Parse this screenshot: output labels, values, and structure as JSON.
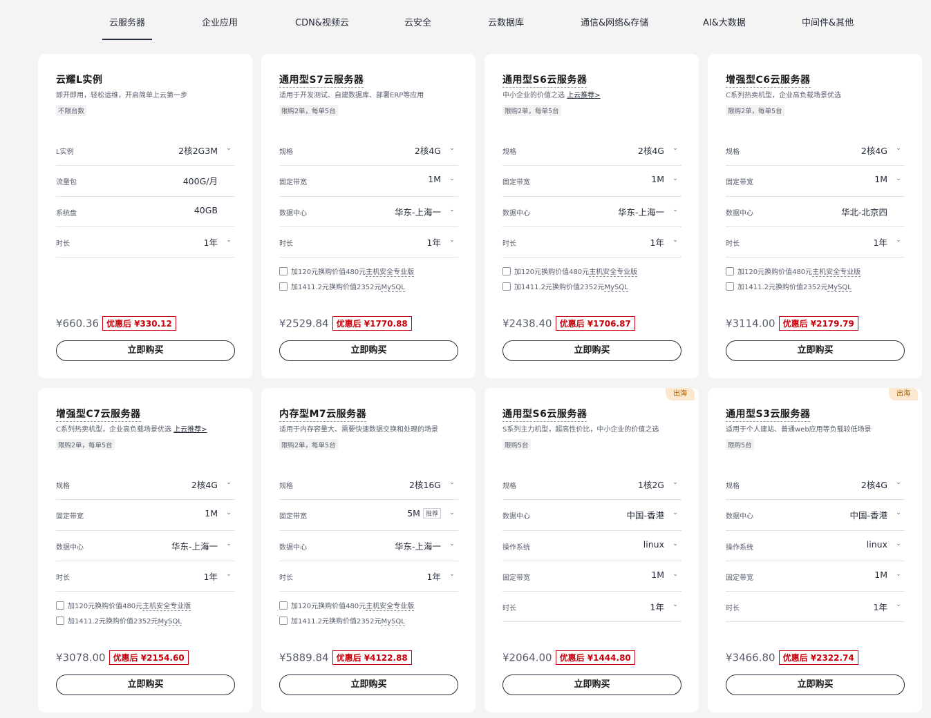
{
  "tabs": [
    {
      "label": "云服务器"
    },
    {
      "label": "企业应用"
    },
    {
      "label": "CDN&视频云"
    },
    {
      "label": "云安全"
    },
    {
      "label": "云数据库"
    },
    {
      "label": "通信&网络&存储"
    },
    {
      "label": "AI&大数据"
    },
    {
      "label": "中间件&其他"
    }
  ],
  "active_tab": "云服务器",
  "common": {
    "buy_label": "立即购买",
    "addon1": {
      "pre": "加120元换购价值480元",
      "link": "主机安全专业版"
    },
    "addon2": {
      "pre": "加1411.2元换购价值2352元",
      "link": "MySQL"
    },
    "recommend_tag": "推荐",
    "recommend_link": "上云推荐>",
    "badge": "出海"
  },
  "cards": [
    {
      "title": "云耀L实例",
      "desc": "即开即用，轻松运维，开启简单上云第一步",
      "limit": "不限台数",
      "rows": [
        {
          "label": "L实例",
          "value": "2核2G3M"
        },
        {
          "label": "流量包",
          "value": "400G/月"
        },
        {
          "label": "系统盘",
          "value": "40GB"
        },
        {
          "label": "时长",
          "value": "1年"
        }
      ],
      "orig_price": "¥660.36",
      "disc_price": "优惠后 ¥330.12"
    },
    {
      "title": "通用型S7云服务器",
      "desc": "适用于开发测试、自建数据库、部署ERP等应用",
      "limit": "限购2单，每单5台",
      "rows": [
        {
          "label": "规格",
          "value": "2核4G"
        },
        {
          "label": "固定带宽",
          "value": "1M"
        },
        {
          "label": "数据中心",
          "value": "华东-上海一"
        },
        {
          "label": "时长",
          "value": "1年"
        }
      ],
      "orig_price": "¥2529.84",
      "disc_price": "优惠后 ¥1770.88"
    },
    {
      "title": "通用型S6云服务器",
      "desc": "中小企业的价值之选",
      "limit": "限购2单，每单5台",
      "rows": [
        {
          "label": "规格",
          "value": "2核4G"
        },
        {
          "label": "固定带宽",
          "value": "1M"
        },
        {
          "label": "数据中心",
          "value": "华东-上海一"
        },
        {
          "label": "时长",
          "value": "1年"
        }
      ],
      "orig_price": "¥2438.40",
      "disc_price": "优惠后 ¥1706.87"
    },
    {
      "title": "增强型C6云服务器",
      "desc": "C系列热卖机型，企业高负载场景优选",
      "limit": "限购2单，每单5台",
      "rows": [
        {
          "label": "规格",
          "value": "2核4G"
        },
        {
          "label": "固定带宽",
          "value": "1M"
        },
        {
          "label": "数据中心",
          "value": "华北-北京四"
        },
        {
          "label": "时长",
          "value": "1年"
        }
      ],
      "orig_price": "¥3114.00",
      "disc_price": "优惠后 ¥2179.79"
    },
    {
      "title": "增强型C7云服务器",
      "desc": "C系列热卖机型，企业高负载场景优选",
      "limit": "限购2单，每单5台",
      "rows": [
        {
          "label": "规格",
          "value": "2核4G"
        },
        {
          "label": "固定带宽",
          "value": "1M"
        },
        {
          "label": "数据中心",
          "value": "华东-上海一"
        },
        {
          "label": "时长",
          "value": "1年"
        }
      ],
      "orig_price": "¥3078.00",
      "disc_price": "优惠后 ¥2154.60"
    },
    {
      "title": "内存型M7云服务器",
      "desc": "适用于内存容量大、需要快速数据交换和处理的场景",
      "limit": "限购2单，每单5台",
      "rows": [
        {
          "label": "规格",
          "value": "2核16G"
        },
        {
          "label": "固定带宽",
          "value": "5M"
        },
        {
          "label": "数据中心",
          "value": "华东-上海一"
        },
        {
          "label": "时长",
          "value": "1年"
        }
      ],
      "orig_price": "¥5889.84",
      "disc_price": "优惠后 ¥4122.88"
    },
    {
      "title": "通用型S6云服务器",
      "desc": "S系列主力机型，超高性价比，中小企业的价值之选",
      "limit": "限购5台",
      "rows": [
        {
          "label": "规格",
          "value": "1核2G"
        },
        {
          "label": "数据中心",
          "value": "中国-香港"
        },
        {
          "label": "操作系统",
          "value": "linux"
        },
        {
          "label": "固定带宽",
          "value": "1M"
        },
        {
          "label": "时长",
          "value": "1年"
        }
      ],
      "orig_price": "¥2064.00",
      "disc_price": "优惠后 ¥1444.80"
    },
    {
      "title": "通用型S3云服务器",
      "desc": "适用于个人建站、普通web应用等负载较低场景",
      "limit": "限购5台",
      "rows": [
        {
          "label": "规格",
          "value": "2核4G"
        },
        {
          "label": "数据中心",
          "value": "中国-香港"
        },
        {
          "label": "操作系统",
          "value": "linux"
        },
        {
          "label": "固定带宽",
          "value": "1M"
        },
        {
          "label": "时长",
          "value": "1年"
        }
      ],
      "orig_price": "¥3466.80",
      "disc_price": "优惠后 ¥2322.74"
    }
  ]
}
